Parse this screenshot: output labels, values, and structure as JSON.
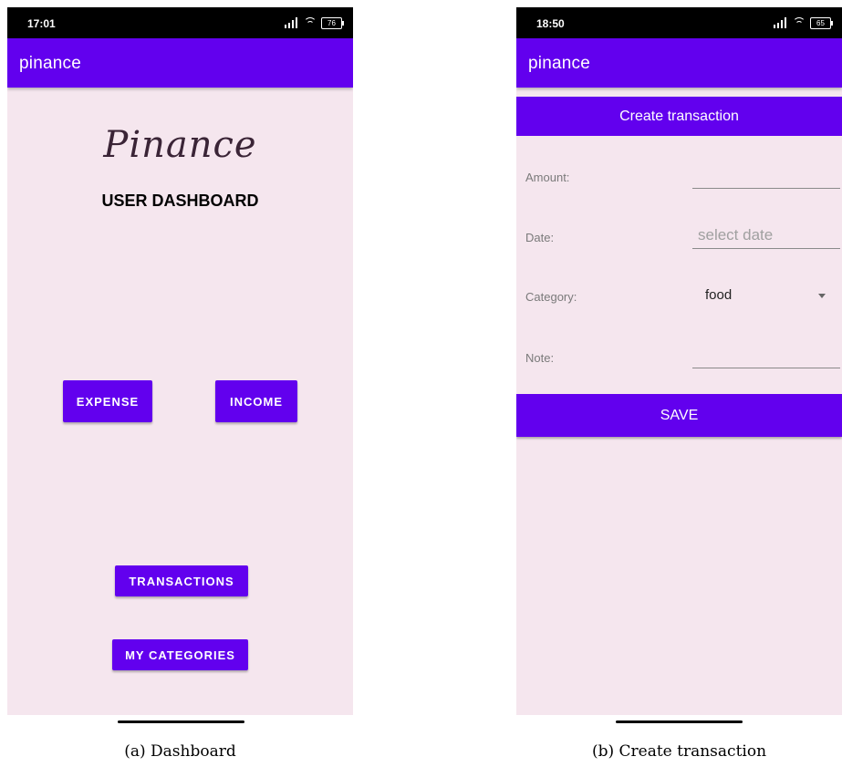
{
  "dashboard": {
    "status_time": "17:01",
    "battery": "76",
    "appbar_title": "pinance",
    "logo_text": "Pinance",
    "heading": "USER DASHBOARD",
    "expense_label": "EXPENSE",
    "income_label": "INCOME",
    "transactions_label": "TRANSACTIONS",
    "categories_label": "MY CATEGORIES",
    "caption": "(a) Dashboard"
  },
  "create": {
    "status_time": "18:50",
    "battery": "65",
    "appbar_title": "pinance",
    "banner": "Create transaction",
    "amount_label": "Amount:",
    "amount_value": "",
    "date_label": "Date:",
    "date_placeholder": "select date",
    "category_label": "Category:",
    "category_value": "food",
    "note_label": "Note:",
    "note_value": "",
    "save_label": "SAVE",
    "caption": "(b) Create transaction"
  },
  "colors": {
    "primary": "#6200ee",
    "background": "#f5e6ee",
    "status_bar": "#000000"
  },
  "icons": {
    "signal": "signal-icon",
    "wifi": "wifi-icon",
    "battery": "battery-icon",
    "dropdown": "dropdown-caret-icon"
  }
}
